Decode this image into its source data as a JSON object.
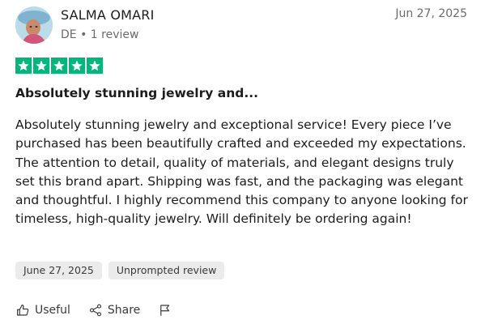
{
  "reviewer": {
    "name": "SALMA OMARI",
    "meta": "DE • 1 review"
  },
  "review": {
    "date": "Jun 27, 2025",
    "rating": 5,
    "title": "Absolutely stunning jewelry and...",
    "body": "Absolutely stunning jewelry and exceptional service! Every piece I’ve purchased has been beautifully crafted and exceeded my expectations. The attention to detail, quality of materials, and elegant designs truly set this brand apart. Shipping was fast, and the packaging was elegant and thoughtful. I highly recommend this company to anyone looking for timeless, high-quality jewelry. Will definitely be ordering again!",
    "tags": [
      "June 27, 2025",
      "Unprompted review"
    ]
  },
  "actions": {
    "useful_label": "Useful",
    "share_label": "Share",
    "useful_icon": "thumbs-up-icon",
    "share_icon": "share-icon",
    "report_icon": "flag-icon"
  },
  "colors": {
    "star": "#00b67a",
    "tag_bg": "#ebebeb"
  }
}
